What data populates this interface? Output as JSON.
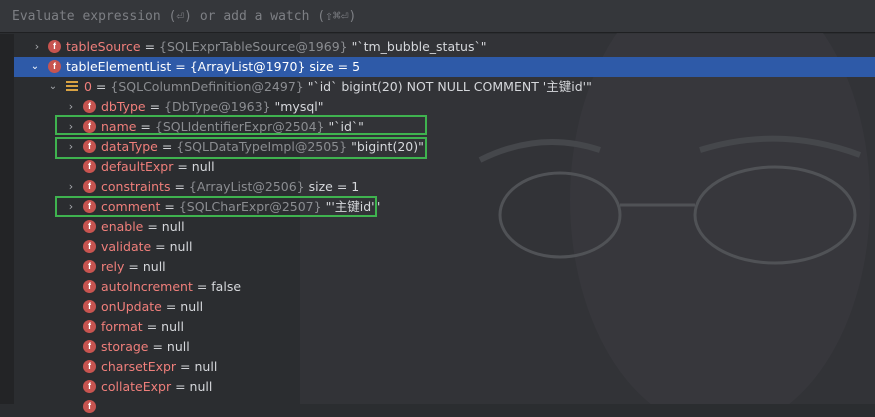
{
  "eval": {
    "placeholder": "Evaluate expression (⏎) or add a watch (⇧⌘⏎)"
  },
  "rows": [
    {
      "name": "tableSource",
      "eq": " = ",
      "type": "{SQLExprTableSource@1969}",
      "val": " \"`tm_bubble_status`\""
    },
    {
      "name": "tableElementList",
      "eq": " = ",
      "type": "{ArrayList@1970}",
      "val": "  size = 5"
    },
    {
      "name": "0",
      "eq": " = ",
      "type": "{SQLColumnDefinition@2497}",
      "val": " \"`id` bigint(20) NOT NULL COMMENT '主键id'\""
    },
    {
      "name": "dbType",
      "eq": " = ",
      "type": "{DbType@1963}",
      "val": " \"mysql\""
    },
    {
      "name": "name",
      "eq": " = ",
      "type": "{SQLIdentifierExpr@2504}",
      "val": " \"`id`\""
    },
    {
      "name": "dataType",
      "eq": " = ",
      "type": "{SQLDataTypeImpl@2505}",
      "val": " \"bigint(20)\""
    },
    {
      "name": "defaultExpr",
      "eq": " = ",
      "type": "",
      "val": "null"
    },
    {
      "name": "constraints",
      "eq": " = ",
      "type": "{ArrayList@2506}",
      "val": "  size = 1"
    },
    {
      "name": "comment",
      "eq": " = ",
      "type": "{SQLCharExpr@2507}",
      "val": " \"'主键id'\""
    },
    {
      "name": "enable",
      "eq": " = ",
      "type": "",
      "val": "null"
    },
    {
      "name": "validate",
      "eq": " = ",
      "type": "",
      "val": "null"
    },
    {
      "name": "rely",
      "eq": " = ",
      "type": "",
      "val": "null"
    },
    {
      "name": "autoIncrement",
      "eq": " = ",
      "type": "",
      "val": "false"
    },
    {
      "name": "onUpdate",
      "eq": " = ",
      "type": "",
      "val": "null"
    },
    {
      "name": "format",
      "eq": " = ",
      "type": "",
      "val": "null"
    },
    {
      "name": "storage",
      "eq": " = ",
      "type": "",
      "val": "null"
    },
    {
      "name": "charsetExpr",
      "eq": " = ",
      "type": "",
      "val": "null"
    },
    {
      "name": "collateExpr",
      "eq": " = ",
      "type": "",
      "val": "null"
    }
  ],
  "colors": {
    "selected": "#2e5aa8",
    "highlight": "#3fb34f",
    "field_badge": "#c75450"
  },
  "icons": {
    "field": "field-f-icon",
    "list": "list-icon",
    "expand": "chevron-right-icon",
    "collapse": "chevron-down-icon"
  }
}
